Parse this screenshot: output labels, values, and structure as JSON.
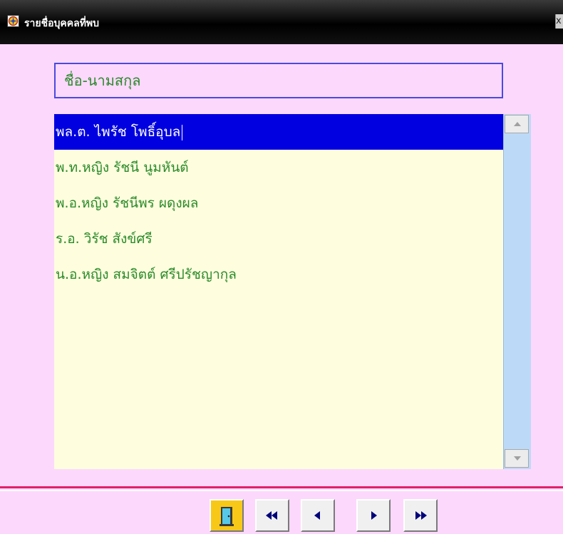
{
  "window": {
    "title": "รายชื่อบุคคลที่พบ",
    "close_glyph": "x"
  },
  "header": {
    "column_label": "ชื่อ-นามสกุล"
  },
  "list": {
    "selected_index": 0,
    "items": [
      "พล.ต. ไพรัช  โพธิ์อุบล",
      "พ.ท.หญิง รัชนี  นูมหันต์",
      "พ.อ.หญิง รัชนีพร  ผดุงผล",
      "ร.อ. วิรัช  สังข์ศรี",
      "น.อ.หญิง สมจิตต์  ศรีปรัชญากุล"
    ]
  },
  "navigation": {
    "icons": [
      "exit-door-icon",
      "first-record-icon",
      "previous-record-icon",
      "next-record-icon",
      "last-record-icon"
    ]
  },
  "colors": {
    "background": "#fdd8fd",
    "list_background": "#fefede",
    "selection": "#0000e0",
    "text": "#2a8a2a",
    "divider": "#e0226a",
    "exit_button": "#f8c818",
    "arrow": "#00007a"
  }
}
